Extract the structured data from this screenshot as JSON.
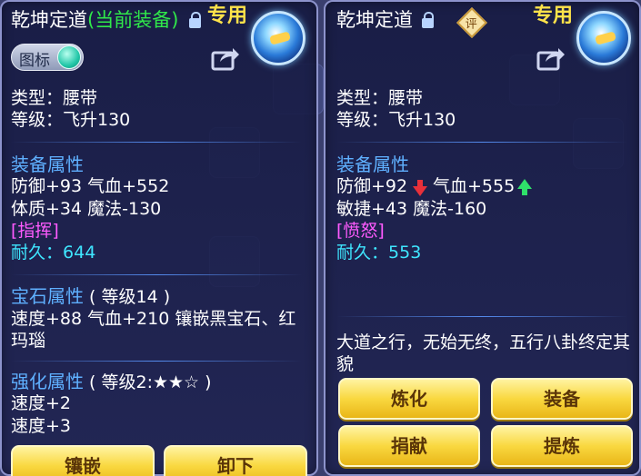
{
  "left": {
    "title": "乾坤定道",
    "title_sub": "(当前装备)",
    "exclusive": "专用",
    "toggle_label": "图标",
    "type": "类型：腰带",
    "level": "等级：飞升130",
    "equip_attr_header": "装备属性",
    "attr_line1": "防御+93 气血+552",
    "attr_line2": "体质+34 魔法-130",
    "special": "[指挥]",
    "durability_label": "耐久：",
    "durability_value": "644",
    "gem_header": "宝石属性",
    "gem_level": "( 等级14 )",
    "gem_desc": "速度+88 气血+210 镶嵌黑宝石、红玛瑙",
    "enhance_header": "强化属性",
    "enhance_level": "( 等级2:★★☆ )",
    "enhance_line1": "速度+2",
    "enhance_line2": "速度+3",
    "btn_inlay": "镶嵌",
    "btn_unequip": "卸下"
  },
  "right": {
    "title": "乾坤定道",
    "rate_badge": "评",
    "exclusive": "专用",
    "type": "类型：腰带",
    "level": "等级：飞升130",
    "equip_attr_header": "装备属性",
    "attr_line1_a": "防御+92",
    "attr_line1_b": "气血+555",
    "attr_line2": "敏捷+43 魔法-160",
    "special": "[愤怒]",
    "durability_label": "耐久：",
    "durability_value": "553",
    "description": "大道之行，无始无终，五行八卦终定其貌",
    "btn_refine": "炼化",
    "btn_equip": "装备",
    "btn_donate": "捐献",
    "btn_purify": "提炼"
  },
  "colors": {
    "panel_bg": "#1e2250",
    "attr_header": "#5fb0ff",
    "special": "#ff5bff",
    "durability": "#3fe6ff",
    "exclusive": "#ffe34a",
    "current_equip": "#30e84a",
    "button_gold": "#f9d840",
    "stat_down": "#e8303a",
    "stat_up": "#2fe06a"
  }
}
